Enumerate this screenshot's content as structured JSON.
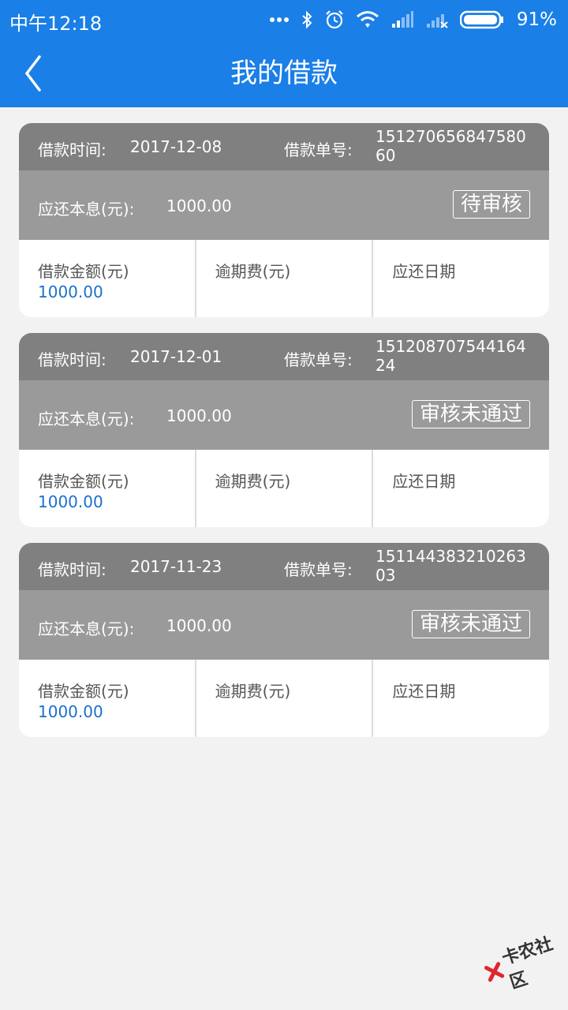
{
  "status_bar": {
    "time": "中午12:18",
    "battery": "91%"
  },
  "nav": {
    "title": "我的借款"
  },
  "labels": {
    "loan_time": "借款时间:",
    "order_no": "借款单号:",
    "due_principal": "应还本息(元):",
    "loan_amount": "借款金额(元)",
    "overdue_fee": "逾期费(元)",
    "due_date": "应还日期"
  },
  "loans": [
    {
      "loan_time": "2017-12-08",
      "order_no": "15127065684758060",
      "due_principal": "1000.00",
      "status": "待审核",
      "loan_amount": "1000.00",
      "overdue_fee": "",
      "due_date": ""
    },
    {
      "loan_time": "2017-12-01",
      "order_no": "15120870754416424",
      "due_principal": "1000.00",
      "status": "审核未通过",
      "loan_amount": "1000.00",
      "overdue_fee": "",
      "due_date": ""
    },
    {
      "loan_time": "2017-11-23",
      "order_no": "15114438321026303",
      "due_principal": "1000.00",
      "status": "审核未通过",
      "loan_amount": "1000.00",
      "overdue_fee": "",
      "due_date": ""
    }
  ],
  "watermark": {
    "text": "卡农社区"
  },
  "colors": {
    "header": "#1a7fe6",
    "card_top": "#808080",
    "card_mid": "#9a9a9a",
    "amount": "#1a6fcf"
  },
  "icons": [
    "back-chevron-icon",
    "more-dots-icon",
    "bluetooth-icon",
    "alarm-icon",
    "wifi-icon",
    "signal-icon",
    "signal-no-sim-icon",
    "battery-icon"
  ]
}
